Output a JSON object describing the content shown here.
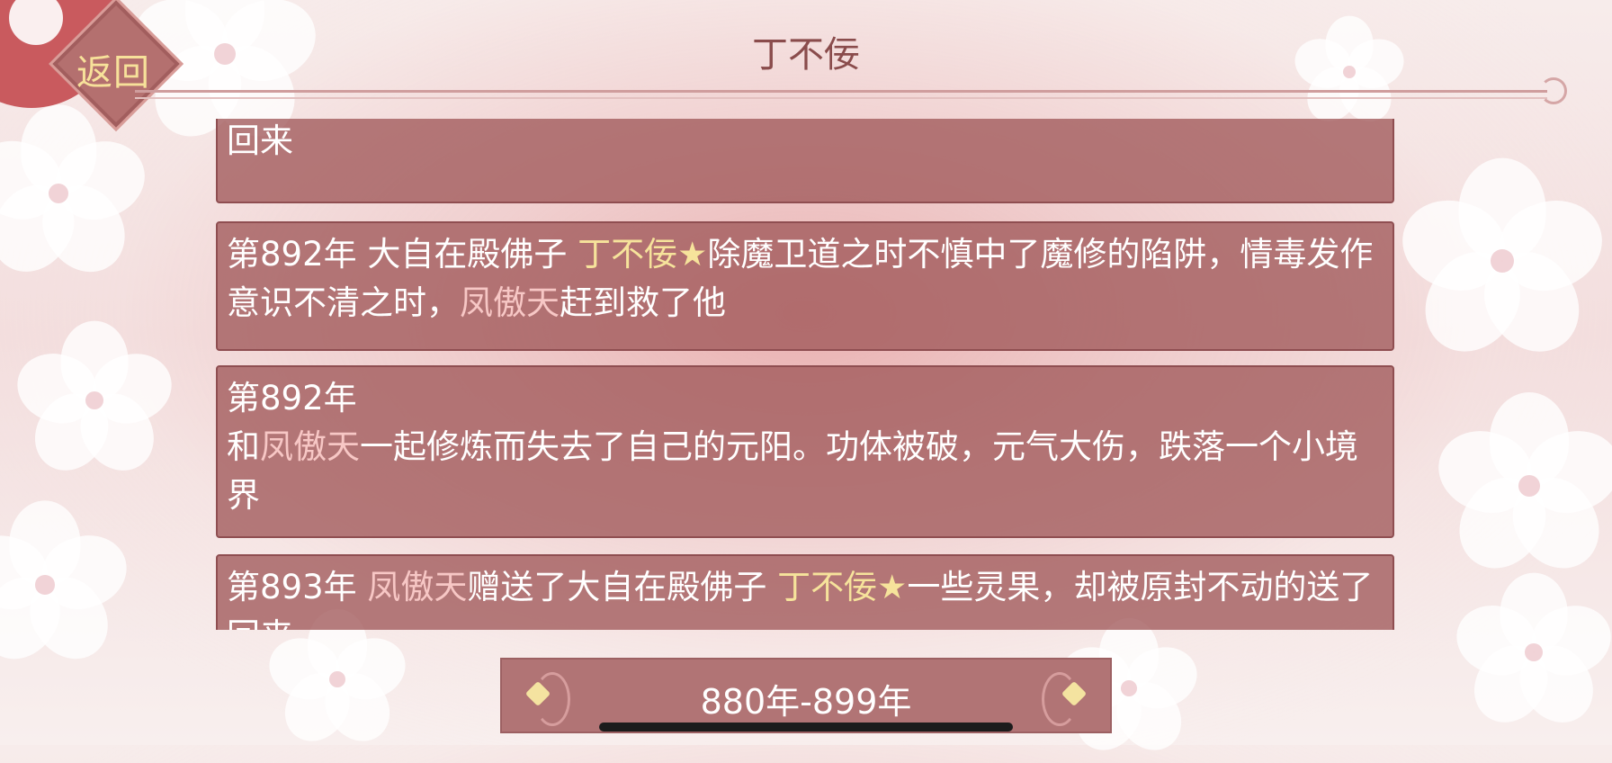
{
  "header": {
    "back_label": "返回",
    "title": "丁不佞"
  },
  "events": [
    {
      "segments": [
        {
          "text": "第893年 ",
          "style": "plain"
        },
        {
          "text": "凤傲天",
          "style": "player"
        },
        {
          "text": "赠送了大自在殿佛子 ",
          "style": "plain"
        },
        {
          "text": "丁不佞★",
          "style": "npc"
        },
        {
          "text": "一些灵果，却被原封不动的送了回来",
          "style": "plain"
        }
      ]
    },
    {
      "segments": [
        {
          "text": "第892年 大自在殿佛子 ",
          "style": "plain"
        },
        {
          "text": "丁不佞★",
          "style": "npc"
        },
        {
          "text": "除魔卫道之时不慎中了魔修的陷阱，情毒发作意识不清之时，",
          "style": "plain"
        },
        {
          "text": "凤傲天",
          "style": "player"
        },
        {
          "text": "赶到救了他",
          "style": "plain"
        }
      ]
    },
    {
      "segments": [
        {
          "text": "第892年\n和",
          "style": "plain"
        },
        {
          "text": "凤傲天",
          "style": "player"
        },
        {
          "text": "一起修炼而失去了自己的元阳。功体被破，元气大伤，跌落一个小境界",
          "style": "plain"
        }
      ]
    },
    {
      "segments": [
        {
          "text": "第893年 ",
          "style": "plain"
        },
        {
          "text": "凤傲天",
          "style": "player"
        },
        {
          "text": "赠送了大自在殿佛子 ",
          "style": "plain"
        },
        {
          "text": "丁不佞★",
          "style": "npc"
        },
        {
          "text": "一些灵果，却被原封不动的送了回来",
          "style": "plain"
        }
      ]
    }
  ],
  "footer": {
    "year_range": "880年-899年",
    "prev_icon": "ornate-left-arrow-icon",
    "next_icon": "ornate-right-arrow-icon"
  },
  "colors": {
    "npc_highlight": "#f6e39b",
    "player_highlight": "#f7c7c5",
    "card_background": "#a0585a"
  }
}
